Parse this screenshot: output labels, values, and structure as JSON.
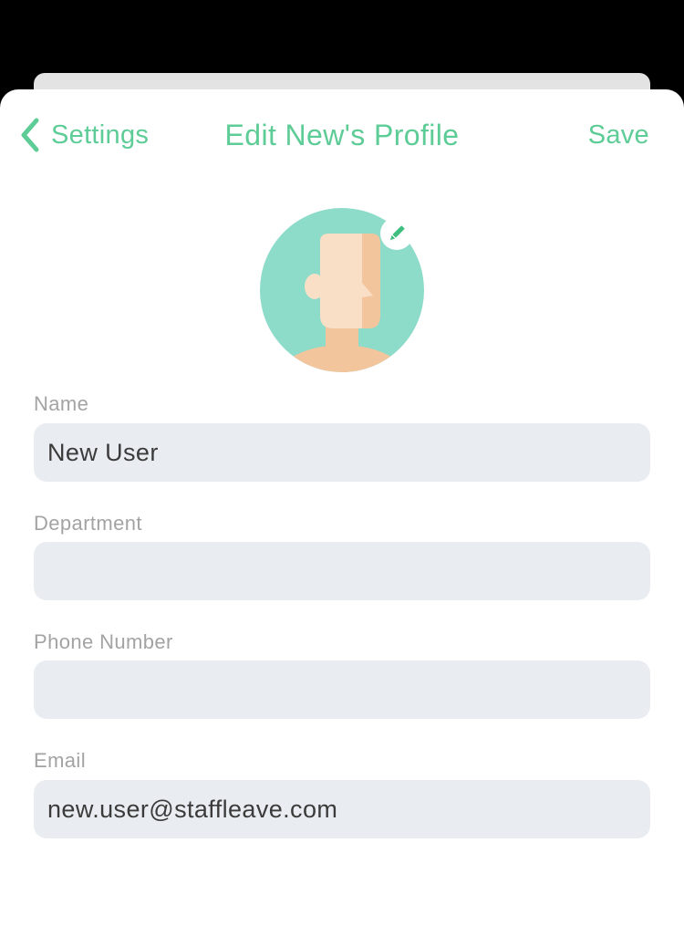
{
  "nav": {
    "back_label": "Settings",
    "title": "Edit New's Profile",
    "save_label": "Save"
  },
  "avatar": {
    "icon": "user-avatar-icon",
    "edit_icon": "pencil-icon"
  },
  "fields": {
    "name": {
      "label": "Name",
      "value": "New User"
    },
    "department": {
      "label": "Department",
      "value": ""
    },
    "phone": {
      "label": "Phone Number",
      "value": ""
    },
    "email": {
      "label": "Email",
      "value": "new.user@staffleave.com"
    }
  },
  "colors": {
    "accent": "#5ecc96",
    "avatar_bg": "#8ddbc9",
    "field_bg": "#e9edf1",
    "label_text": "#a3a3a3",
    "value_text": "#3b3b3b"
  }
}
